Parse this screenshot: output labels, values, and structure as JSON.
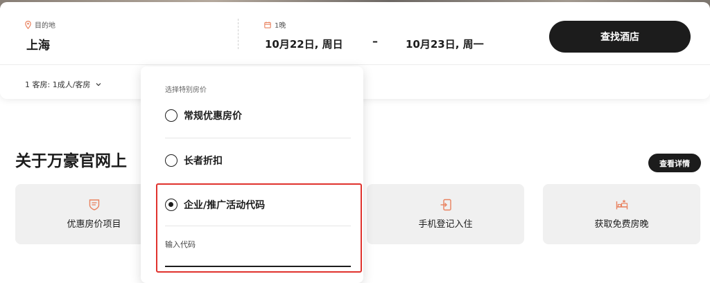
{
  "colors": {
    "accent": "#e9825f",
    "button_bg": "#1c1c1c",
    "card_bg": "#f0f0f0",
    "highlight": "#e0322d"
  },
  "search": {
    "destination_label": "目的地",
    "destination_value": "上海",
    "nights_label": "1晚",
    "checkin": "10月22日, 周日",
    "separator": "–",
    "checkout": "10月23日, 周一",
    "search_button": "查找酒店",
    "rooms_text": "1 客房: 1成人/客房"
  },
  "section": {
    "title": "关于万豪官网上",
    "detail_button": "查看详情",
    "benefits": [
      {
        "label": "优惠房价项目",
        "icon": "tag-shield-icon"
      },
      {
        "label": "手机登记入住",
        "icon": "mobile-checkin-icon"
      },
      {
        "label": "获取免费房晚",
        "icon": "free-night-bed-icon"
      }
    ]
  },
  "rate_popup": {
    "heading": "选择特别房价",
    "options": [
      {
        "label": "常规优惠房价",
        "selected": false
      },
      {
        "label": "长者折扣",
        "selected": false
      },
      {
        "label": "企业/推广活动代码",
        "selected": true
      }
    ],
    "code_placeholder": "输入代码"
  }
}
